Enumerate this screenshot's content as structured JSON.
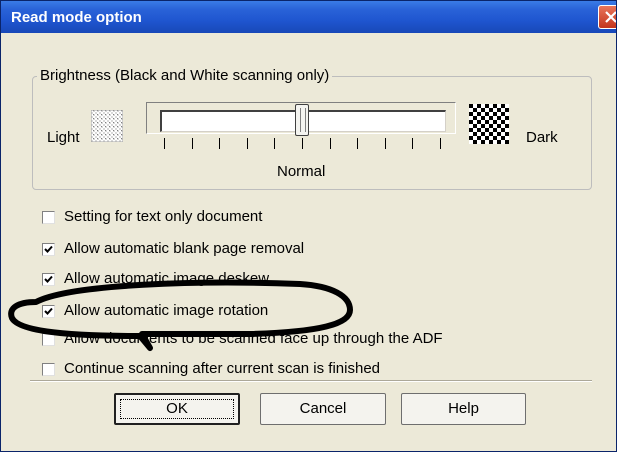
{
  "window": {
    "title": "Read mode option"
  },
  "brightness": {
    "group_title": "Brightness (Black and White scanning only)",
    "light_label": "Light",
    "dark_label": "Dark",
    "normal_label": "Normal",
    "slider_value_fraction": 0.5,
    "tick_count": 11
  },
  "options": [
    {
      "label": "Setting for text only document",
      "checked": false
    },
    {
      "label": "Allow automatic blank page removal",
      "checked": true
    },
    {
      "label": "Allow automatic image deskew",
      "checked": true
    },
    {
      "label": "Allow automatic image rotation",
      "checked": true
    },
    {
      "label": "Allow documents to be scanned face up through the ADF",
      "checked": false
    },
    {
      "label": "Continue scanning after current scan is finished",
      "checked": false
    }
  ],
  "buttons": {
    "ok": "OK",
    "cancel": "Cancel",
    "help": "Help"
  },
  "annotation": {
    "shape": "hand-drawn oval",
    "highlights": "Allow automatic image rotation"
  },
  "colors": {
    "titlebar": "#2a63d8",
    "dialog": "#ece9d8",
    "close": "#c4351d"
  }
}
